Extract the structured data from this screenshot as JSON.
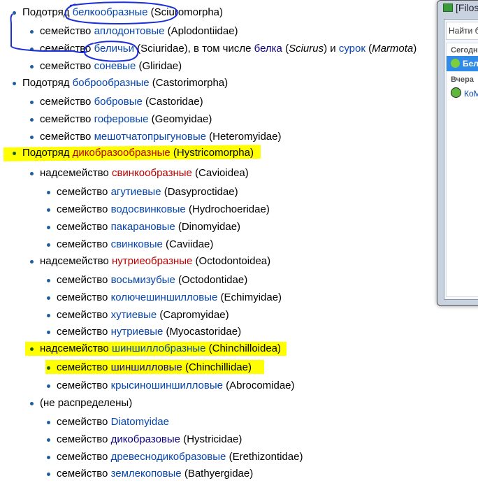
{
  "colors": {
    "link": "#0645ad",
    "redlink": "#ba0000",
    "visited": "#0b0080",
    "highlight": "#ffff00",
    "pen": "#1a2fd8"
  },
  "tree": [
    {
      "level": 0,
      "parts": [
        [
          "text",
          "Подотряд "
        ],
        [
          "link",
          "белкообразные"
        ],
        [
          "text",
          " (Sciuromorpha)"
        ]
      ]
    },
    {
      "level": 1,
      "parts": [
        [
          "text",
          "семейство "
        ],
        [
          "link",
          "аплодонтовые"
        ],
        [
          "text",
          " (Aplodontiidae)"
        ]
      ]
    },
    {
      "level": 1,
      "parts": [
        [
          "text",
          "семейство "
        ],
        [
          "link",
          "беличьи"
        ],
        [
          "text",
          " (Sciuridae), в том числе "
        ],
        [
          "visited",
          "белка"
        ],
        [
          "text",
          " ("
        ],
        [
          "it",
          "Sciurus"
        ],
        [
          "text",
          ") и "
        ],
        [
          "link",
          "сурок"
        ],
        [
          "text",
          " ("
        ],
        [
          "it",
          "Marmota"
        ],
        [
          "text",
          ")"
        ]
      ]
    },
    {
      "level": 1,
      "parts": [
        [
          "text",
          "семейство "
        ],
        [
          "link",
          "соневые"
        ],
        [
          "text",
          " (Gliridae)"
        ]
      ]
    },
    {
      "level": 0,
      "parts": [
        [
          "text",
          "Подотряд "
        ],
        [
          "link",
          "боброобразные"
        ],
        [
          "text",
          " (Castorimorpha)"
        ]
      ]
    },
    {
      "level": 1,
      "parts": [
        [
          "text",
          "семейство "
        ],
        [
          "link",
          "бобровые"
        ],
        [
          "text",
          " (Castoridae)"
        ]
      ]
    },
    {
      "level": 1,
      "parts": [
        [
          "text",
          "семейство "
        ],
        [
          "link",
          "гоферовые"
        ],
        [
          "text",
          " (Geomyidae)"
        ]
      ]
    },
    {
      "level": 1,
      "parts": [
        [
          "text",
          "семейство "
        ],
        [
          "link",
          "мешотчатопрыгуновые"
        ],
        [
          "text",
          " (Heteromyidae)"
        ]
      ]
    },
    {
      "level": 0,
      "marked": true,
      "parts": [
        [
          "text",
          "Подотряд "
        ],
        [
          "red",
          "дикобразообразные"
        ],
        [
          "text",
          " (Hystricomorpha)"
        ]
      ]
    },
    {
      "level": 1,
      "parts": [
        [
          "text",
          "надсемейство "
        ],
        [
          "red",
          "свинкообразные"
        ],
        [
          "text",
          " (Cavioidea)"
        ]
      ]
    },
    {
      "level": 2,
      "parts": [
        [
          "text",
          "семейство "
        ],
        [
          "link",
          "агутиевые"
        ],
        [
          "text",
          " (Dasyproctidae)"
        ]
      ]
    },
    {
      "level": 2,
      "parts": [
        [
          "text",
          "семейство "
        ],
        [
          "link",
          "водосвинковые"
        ],
        [
          "text",
          " (Hydrochoeridae)"
        ]
      ]
    },
    {
      "level": 2,
      "parts": [
        [
          "text",
          "семейство "
        ],
        [
          "link",
          "пакарановые"
        ],
        [
          "text",
          " (Dinomyidae)"
        ]
      ]
    },
    {
      "level": 2,
      "parts": [
        [
          "text",
          "семейство "
        ],
        [
          "link",
          "свинковые"
        ],
        [
          "text",
          " (Caviidae)"
        ]
      ]
    },
    {
      "level": 1,
      "parts": [
        [
          "text",
          "надсемейство "
        ],
        [
          "red",
          "нутриеобразные"
        ],
        [
          "text",
          " (Octodontoidea)"
        ]
      ]
    },
    {
      "level": 2,
      "parts": [
        [
          "text",
          "семейство "
        ],
        [
          "link",
          "восьмизубые"
        ],
        [
          "text",
          " (Octodontidae)"
        ]
      ]
    },
    {
      "level": 2,
      "parts": [
        [
          "text",
          "семейство "
        ],
        [
          "link",
          "колючешиншилловые"
        ],
        [
          "text",
          " (Echimyidae)"
        ]
      ]
    },
    {
      "level": 2,
      "parts": [
        [
          "text",
          "семейство "
        ],
        [
          "link",
          "хутиевые"
        ],
        [
          "text",
          " (Capromyidae)"
        ]
      ]
    },
    {
      "level": 2,
      "parts": [
        [
          "text",
          "семейство "
        ],
        [
          "link",
          "нутриевые"
        ],
        [
          "text",
          " (Myocastoridae)"
        ]
      ]
    },
    {
      "level": 1,
      "marked": true,
      "parts": [
        [
          "text",
          "надсемейство "
        ],
        [
          "link",
          "шиншиллобразные"
        ],
        [
          "text",
          " (Chinchilloidea)"
        ]
      ]
    },
    {
      "level": 2,
      "marked": true,
      "parts": [
        [
          "text",
          "семейство "
        ],
        [
          "visited",
          "шиншилловые"
        ],
        [
          "text",
          " (Chinchillidae)"
        ]
      ]
    },
    {
      "level": 2,
      "parts": [
        [
          "text",
          "семейство "
        ],
        [
          "link",
          "крысиношиншилловые"
        ],
        [
          "text",
          " (Abrocomidae)"
        ]
      ]
    },
    {
      "level": 1,
      "parts": [
        [
          "text",
          "(не распределены)"
        ]
      ]
    },
    {
      "level": 2,
      "parts": [
        [
          "text",
          "семейство "
        ],
        [
          "link",
          "Diatomyidae"
        ]
      ]
    },
    {
      "level": 2,
      "parts": [
        [
          "text",
          "семейство "
        ],
        [
          "visited",
          "дикобразовые"
        ],
        [
          "text",
          " (Hystricidae)"
        ]
      ]
    },
    {
      "level": 2,
      "parts": [
        [
          "text",
          "семейство "
        ],
        [
          "link",
          "древеснодикобразовые"
        ],
        [
          "text",
          " (Erethizontidae)"
        ]
      ]
    },
    {
      "level": 2,
      "parts": [
        [
          "text",
          "семейство "
        ],
        [
          "link",
          "землекоповые"
        ],
        [
          "text",
          " (Bathyergidae)"
        ]
      ]
    }
  ],
  "window": {
    "title": "[Filoso",
    "search_placeholder": "Найти бе",
    "group_today": "Сегодн",
    "selected_contact": "Бел",
    "group_yesterday": "Вчера",
    "contact": "КоМ",
    "icons": [
      "app-icon",
      "user-icon",
      "clover-glasses-icon"
    ]
  }
}
